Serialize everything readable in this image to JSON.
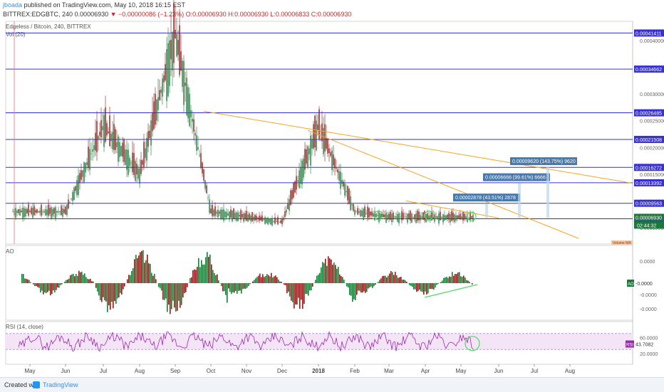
{
  "header": {
    "author": "jboada",
    "published": "published on TradingView.com, May 10, 2018 16:15 EST",
    "symbol_line_prefix": "BITTREX:EDGBTC, 240",
    "price": "0.00006930",
    "change": "▼ −0.00000086 (−1.23%)",
    "ohlc": "O:0.00006930 H:0.00006930 L:0.00006833 C:0.00006930"
  },
  "main_pane": {
    "title": "Edgeless / Bitcoin, 240, BITTREX",
    "vol_label": "Vol (20)",
    "volume_tag": "Volume MA"
  },
  "ao_pane": {
    "title": "AO",
    "tag_label": "AO",
    "tag_value": "-0.0000"
  },
  "rsi_pane": {
    "title": "RSI (14, close)",
    "tag_label": "RSI",
    "tag_value": "43.7082"
  },
  "footer": {
    "created_with": "Created with",
    "brand": "TradingView"
  },
  "colors": {
    "level_line": "#3730d4",
    "trend_line": "#f5a623",
    "bull": "#1b7a3a",
    "bear": "#8b1a1a",
    "rsi_line": "#9c27b0",
    "rsi_band": "#f3e5f5",
    "ao_trend": "#4cd964",
    "circle": "#4cd964",
    "measure": "#bcd7f0"
  },
  "chart_data": [
    {
      "type": "line",
      "panel": "price",
      "x_ticks": [
        "May",
        "Jun",
        "Jul",
        "Aug",
        "Sep",
        "Oct",
        "Nov",
        "Dec",
        "2018",
        "Feb",
        "Mar",
        "Apr",
        "May",
        "Jun",
        "Jul",
        "Aug"
      ],
      "y_ticks": [
        "0.00040000",
        "0.00030000",
        "0.00025000",
        "0.00020000",
        "0.00015000",
        "0.00010000",
        "0.00005000"
      ],
      "ylim": [
        3e-05,
        0.00042
      ],
      "series": [
        {
          "x": [
            "May",
            "Jun",
            "Jul",
            "Aug",
            "Sep",
            "Oct",
            "Nov",
            "Dec",
            "2018",
            "Feb",
            "Mar",
            "Apr",
            "May"
          ],
          "values": [
            8e-05,
            8e-05,
            0.00024,
            0.00015,
            0.00041,
            8e-05,
            7e-05,
            6e-05,
            0.00024,
            8e-05,
            7e-05,
            7e-05,
            6.93e-05
          ]
        }
      ],
      "horizontal_levels": [
        "0.00041411",
        "0.00034662",
        "0.00026485",
        "0.00021508",
        "0.00016272",
        "0.00013392",
        "0.00009563",
        "0.00006653"
      ],
      "price_tag": "0.00006930",
      "countdown": "02:44:32",
      "measurements": [
        "0.00002878 (43.51%) 2878",
        "0.00006666 (99.61%) 6666",
        "0.00009620 (143.75%) 9620"
      ]
    },
    {
      "type": "bar",
      "panel": "AO",
      "y_ticks": [
        "0.0000",
        "-0.0000",
        "-0.0000"
      ],
      "current": "-0.0000"
    },
    {
      "type": "line",
      "panel": "RSI",
      "y_ticks": [
        "60.0000",
        "20.0000"
      ],
      "bands": [
        70,
        30
      ],
      "current": "43.7082"
    }
  ]
}
